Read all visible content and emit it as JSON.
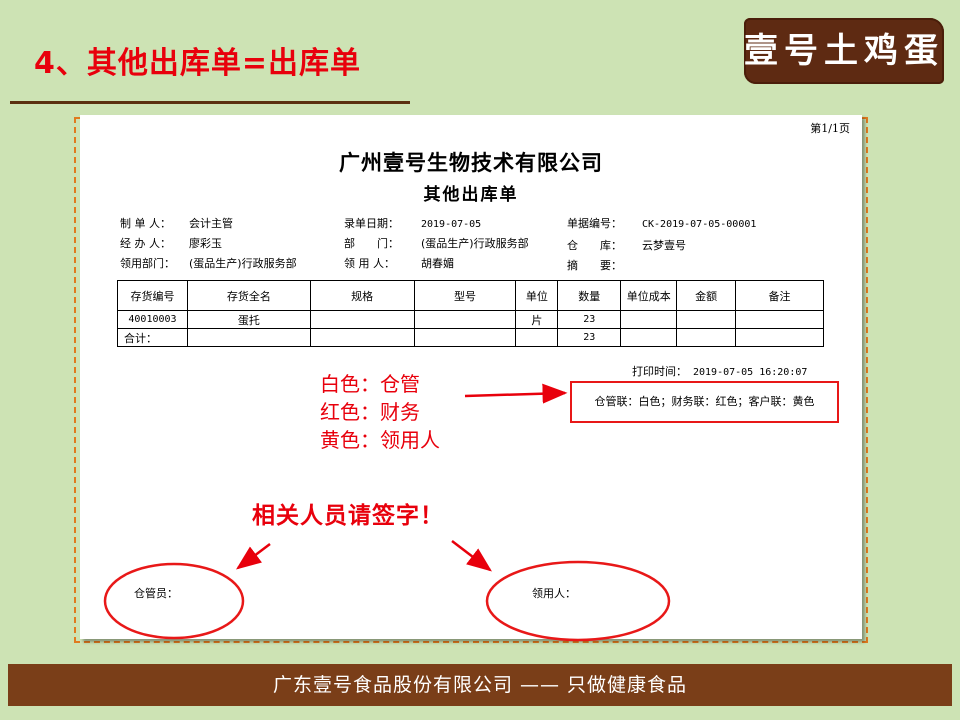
{
  "slide": {
    "title": "4、其他出库单=出库单",
    "logo_text": "壹号土鸡蛋",
    "footer": "广东壹号食品股份有限公司 —— 只做健康食品"
  },
  "document": {
    "page_no": "第1/1页",
    "company": "广州壹号生物技术有限公司",
    "title": "其他出库单",
    "fields": {
      "creator_label": "制 单 人：",
      "creator": "会计主管",
      "handler_label": "经 办 人：",
      "handler": "廖彩玉",
      "dept_label": "领用部门：",
      "dept": "(蛋品生产)行政服务部",
      "entry_date_label": "录单日期：",
      "entry_date": "2019-07-05",
      "department_label": "部　　门：",
      "department": "(蛋品生产)行政服务部",
      "receiver_label": "领 用 人：",
      "receiver": "胡春媚",
      "doc_no_label": "单据编号：",
      "doc_no": "CK-2019-07-05-00001",
      "warehouse_label": "仓　　库：",
      "warehouse": "云梦壹号",
      "summary_label": "摘　　要："
    },
    "table": {
      "headers": [
        "存货编号",
        "存货全名",
        "规格",
        "型号",
        "单位",
        "数量",
        "单位成本",
        "金额",
        "备注"
      ],
      "rows": [
        [
          "40010003",
          "蛋托",
          "",
          "",
          "片",
          "23",
          "",
          "",
          ""
        ]
      ],
      "total_label": "合计：",
      "total_qty": "23"
    },
    "print_time_label": "打印时间：",
    "print_time": "2019-07-05 16:20:07",
    "copy_note": "仓管联：白色；财务联：红色；客户联：黄色",
    "keeper_label": "仓管员：",
    "receiver_sign_label": "领用人："
  },
  "annotations": {
    "legend": [
      "白色：仓管",
      "红色：财务",
      "黄色：领用人"
    ],
    "sign_note": "相关人员请签字！"
  },
  "colors": {
    "background": "#cde3b4",
    "accent_red": "#e8000c",
    "brown": "#7a3e18",
    "dashed_frame": "#e07a1f"
  }
}
